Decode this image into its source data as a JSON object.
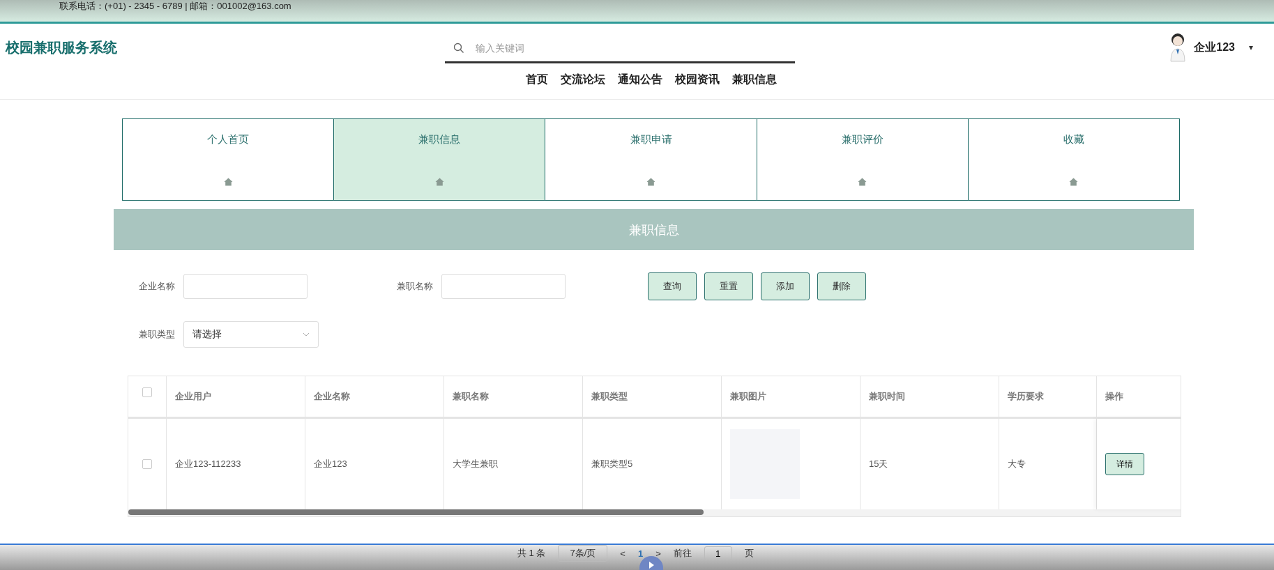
{
  "top_bar": {
    "contact": "联系电话：(+01) - 2345 - 6789 | 邮箱：001002@163.com"
  },
  "header": {
    "logo": "校园兼职服务系统",
    "search": {
      "placeholder": "输入关键词"
    },
    "user": {
      "name": "企业123",
      "caret": "▾"
    }
  },
  "nav": [
    "首页",
    "交流论坛",
    "通知公告",
    "校园资讯",
    "兼职信息"
  ],
  "tabs": [
    {
      "label": "个人首页",
      "selected": false
    },
    {
      "label": "兼职信息",
      "selected": true
    },
    {
      "label": "兼职申请",
      "selected": false
    },
    {
      "label": "兼职评价",
      "selected": false
    },
    {
      "label": "收藏",
      "selected": false
    }
  ],
  "banner": "兼职信息",
  "filters": [
    {
      "label": "企业名称",
      "kind": "input"
    },
    {
      "label": "兼职名称",
      "kind": "input"
    },
    {
      "label": "兼职类型",
      "kind": "select",
      "placeholder": "请选择"
    }
  ],
  "buttons": [
    "查询",
    "重置",
    "添加",
    "删除"
  ],
  "table": {
    "header_checked": false,
    "columns": [
      "企业用户",
      "企业名称",
      "兼职名称",
      "兼职类型",
      "兼职图片",
      "兼职时间",
      "学历要求",
      "操作"
    ],
    "rows": [
      {
        "checked": false,
        "cells": [
          "企业123-112233",
          "企业123",
          "大学生兼职",
          "兼职类型5",
          null,
          "15天",
          "大专"
        ],
        "action": "详情"
      }
    ]
  },
  "pagination": {
    "total": "共 1 条",
    "page_size": "7条/页",
    "prev": "<",
    "pages": [
      {
        "label": "1",
        "selected": true
      }
    ],
    "next": ">",
    "goto": "前往",
    "goto_value": "1",
    "page_word": "页"
  }
}
